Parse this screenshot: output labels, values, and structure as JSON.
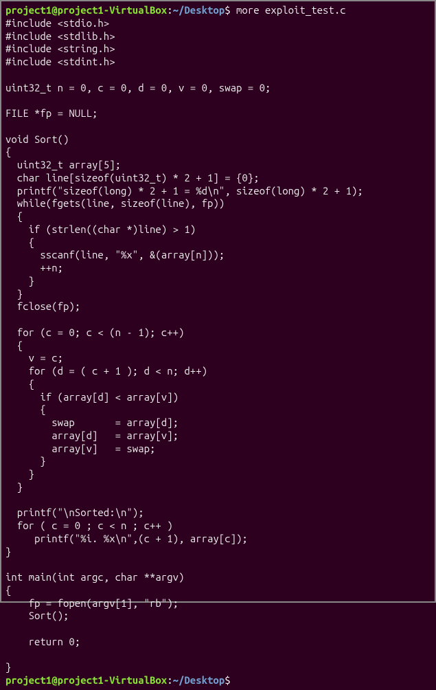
{
  "prompt": {
    "user_host": "project1@project1-VirtualBox",
    "sep1": ":",
    "path": "~/Desktop",
    "sep2": "$ ",
    "command": "more exploit_test.c"
  },
  "code": {
    "l1": "#include <stdio.h>",
    "l2": "#include <stdlib.h>",
    "l3": "#include <string.h>",
    "l4": "#include <stdint.h>",
    "l5": "",
    "l6": "uint32_t n = 0, c = 0, d = 0, v = 0, swap = 0;",
    "l7": "",
    "l8": "FILE *fp = NULL;",
    "l9": "",
    "l10": "void Sort()",
    "l11": "{",
    "l12": "  uint32_t array[5];",
    "l13": "  char line[sizeof(uint32_t) * 2 + 1] = {0};",
    "l14": "  printf(\"sizeof(long) * 2 + 1 = %d\\n\", sizeof(long) * 2 + 1);",
    "l15": "  while(fgets(line, sizeof(line), fp))",
    "l16": "  {",
    "l17": "    if (strlen((char *)line) > 1)",
    "l18": "    {",
    "l19": "      sscanf(line, \"%x\", &(array[n]));",
    "l20": "      ++n;",
    "l21": "    }",
    "l22": "  }",
    "l23": "  fclose(fp);",
    "l24": "",
    "l25": "  for (c = 0; c < (n - 1); c++)",
    "l26": "  {",
    "l27": "    v = c;",
    "l28": "    for (d = ( c + 1 ); d < n; d++)",
    "l29": "    {",
    "l30": "      if (array[d] < array[v])",
    "l31": "      {",
    "l32": "        swap       = array[d];",
    "l33": "        array[d]   = array[v];",
    "l34": "        array[v]   = swap;",
    "l35": "      }",
    "l36": "    }",
    "l37": "  }",
    "l38": "",
    "l39": "  printf(\"\\nSorted:\\n\");",
    "l40": "  for ( c = 0 ; c < n ; c++ )",
    "l41": "     printf(\"%i. %x\\n\",(c + 1), array[c]);",
    "l42": "}",
    "l43": "",
    "l44": "int main(int argc, char **argv)",
    "l45": "{",
    "l46": "    fp = fopen(argv[1], \"rb\");",
    "l47": "    Sort();",
    "l48": "",
    "l49": "    return 0;",
    "l50": "",
    "l51": "}"
  },
  "prompt2": {
    "user_host": "project1@project1-VirtualBox",
    "sep1": ":",
    "path": "~/Desktop",
    "sep2": "$"
  }
}
